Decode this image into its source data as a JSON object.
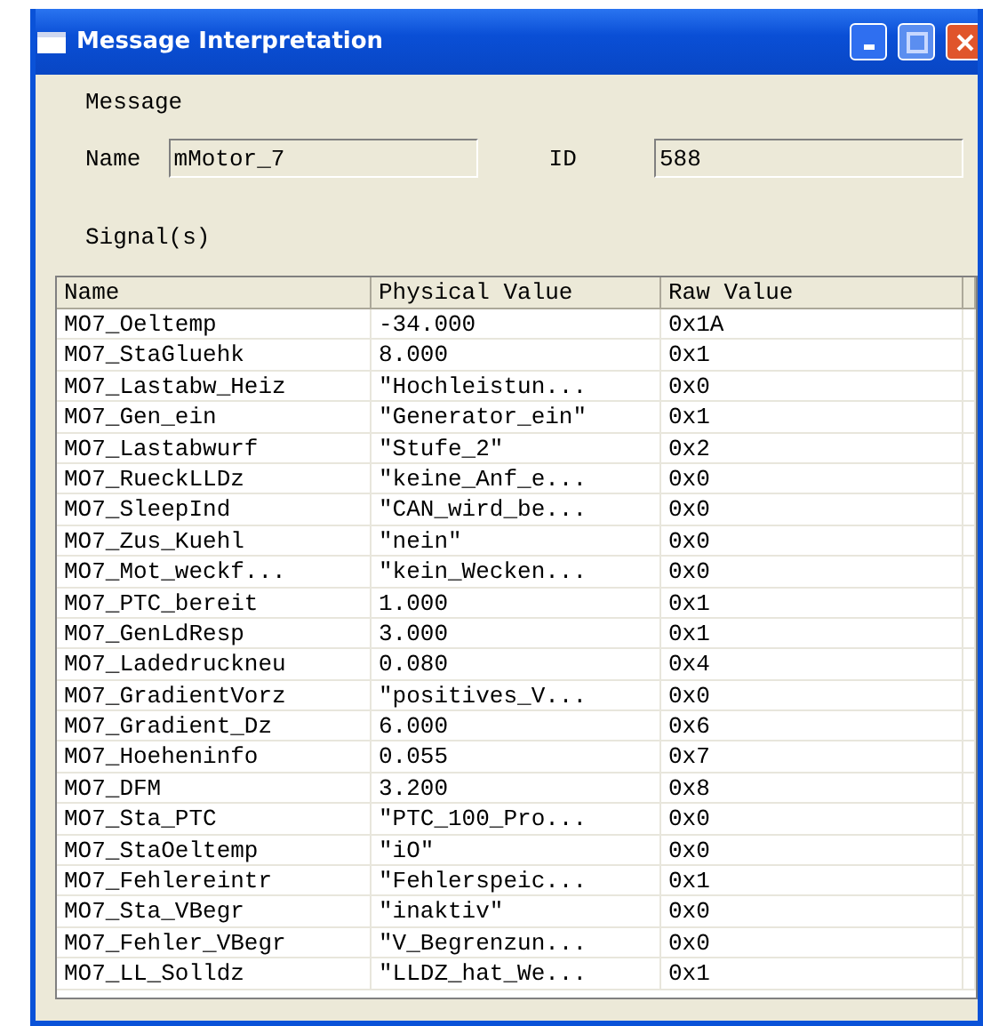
{
  "window": {
    "title": "Message Interpretation"
  },
  "message": {
    "heading": "Message",
    "name_label": "Name",
    "name_value": "mMotor_7",
    "id_label": "ID",
    "id_value": "588"
  },
  "signals": {
    "heading": "Signal(s)",
    "columns": [
      "Name",
      "Physical Value",
      "Raw Value"
    ],
    "rows": [
      [
        "MO7_Oeltemp",
        "-34.000",
        "0x1A"
      ],
      [
        "MO7_StaGluehk",
        "8.000",
        "0x1"
      ],
      [
        "MO7_Lastabw_Heiz",
        "\"Hochleistun...",
        "0x0"
      ],
      [
        "MO7_Gen_ein",
        "\"Generator_ein\"",
        "0x1"
      ],
      [
        "MO7_Lastabwurf",
        "\"Stufe_2\"",
        "0x2"
      ],
      [
        "MO7_RueckLLDz",
        "\"keine_Anf_e...",
        "0x0"
      ],
      [
        "MO7_SleepInd",
        "\"CAN_wird_be...",
        "0x0"
      ],
      [
        "MO7_Zus_Kuehl",
        "\"nein\"",
        "0x0"
      ],
      [
        "MO7_Mot_weckf...",
        "\"kein_Wecken...",
        "0x0"
      ],
      [
        "MO7_PTC_bereit",
        "1.000",
        "0x1"
      ],
      [
        "MO7_GenLdResp",
        "3.000",
        "0x1"
      ],
      [
        "MO7_Ladedruckneu",
        "0.080",
        "0x4"
      ],
      [
        "MO7_GradientVorz",
        "\"positives_V...",
        "0x0"
      ],
      [
        "MO7_Gradient_Dz",
        "6.000",
        "0x6"
      ],
      [
        "MO7_Hoeheninfo",
        "0.055",
        "0x7"
      ],
      [
        "MO7_DFM",
        "3.200",
        "0x8"
      ],
      [
        "MO7_Sta_PTC",
        "\"PTC_100_Pro...",
        "0x0"
      ],
      [
        "MO7_StaOeltemp",
        "\"iO\"",
        "0x0"
      ],
      [
        "MO7_Fehlereintr",
        "\"Fehlerspeic...",
        "0x1"
      ],
      [
        "MO7_Sta_VBegr",
        "\"inaktiv\"",
        "0x0"
      ],
      [
        "MO7_Fehler_VBegr",
        "\"V_Begrenzun...",
        "0x0"
      ],
      [
        "MO7_LL_Solldz",
        "\"LLDZ_hat_We...",
        "0x1"
      ]
    ]
  }
}
